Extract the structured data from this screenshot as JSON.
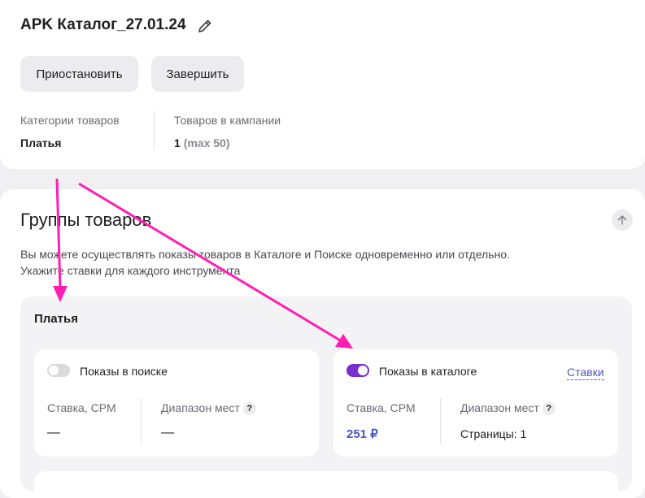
{
  "campaign": {
    "title": "APK Каталог_27.01.24",
    "pause_button": "Приостановить",
    "finish_button": "Завершить",
    "categories_label": "Категории товаров",
    "categories_value": "Платья",
    "products_label": "Товаров в кампании",
    "products_count": "1",
    "products_max": "(max 50)"
  },
  "groups_section": {
    "title": "Группы товаров",
    "description_line1": "Вы можете осуществлять показы товаров в Каталоге и Поиске одновременно или отдельно.",
    "description_line2": "Укажите ставки для каждого инструмента"
  },
  "group": {
    "name": "Платья",
    "search_tool": {
      "label": "Показы в поиске",
      "enabled": false,
      "rate_label": "Ставка, CPM",
      "range_label": "Диапазон мест",
      "rate_value": "—",
      "range_value": "—"
    },
    "catalog_tool": {
      "label": "Показы в каталоге",
      "enabled": true,
      "rates_link": "Ставки",
      "rate_label": "Ставка, CPM",
      "range_label": "Диапазон мест",
      "rate_value": "251 ₽",
      "range_value": "Страницы: 1"
    },
    "help_glyph": "?"
  },
  "colors": {
    "accent_purple": "#7b2ed0",
    "link_blue": "#4b55c8",
    "annotation_magenta": "#ff1eb4"
  }
}
